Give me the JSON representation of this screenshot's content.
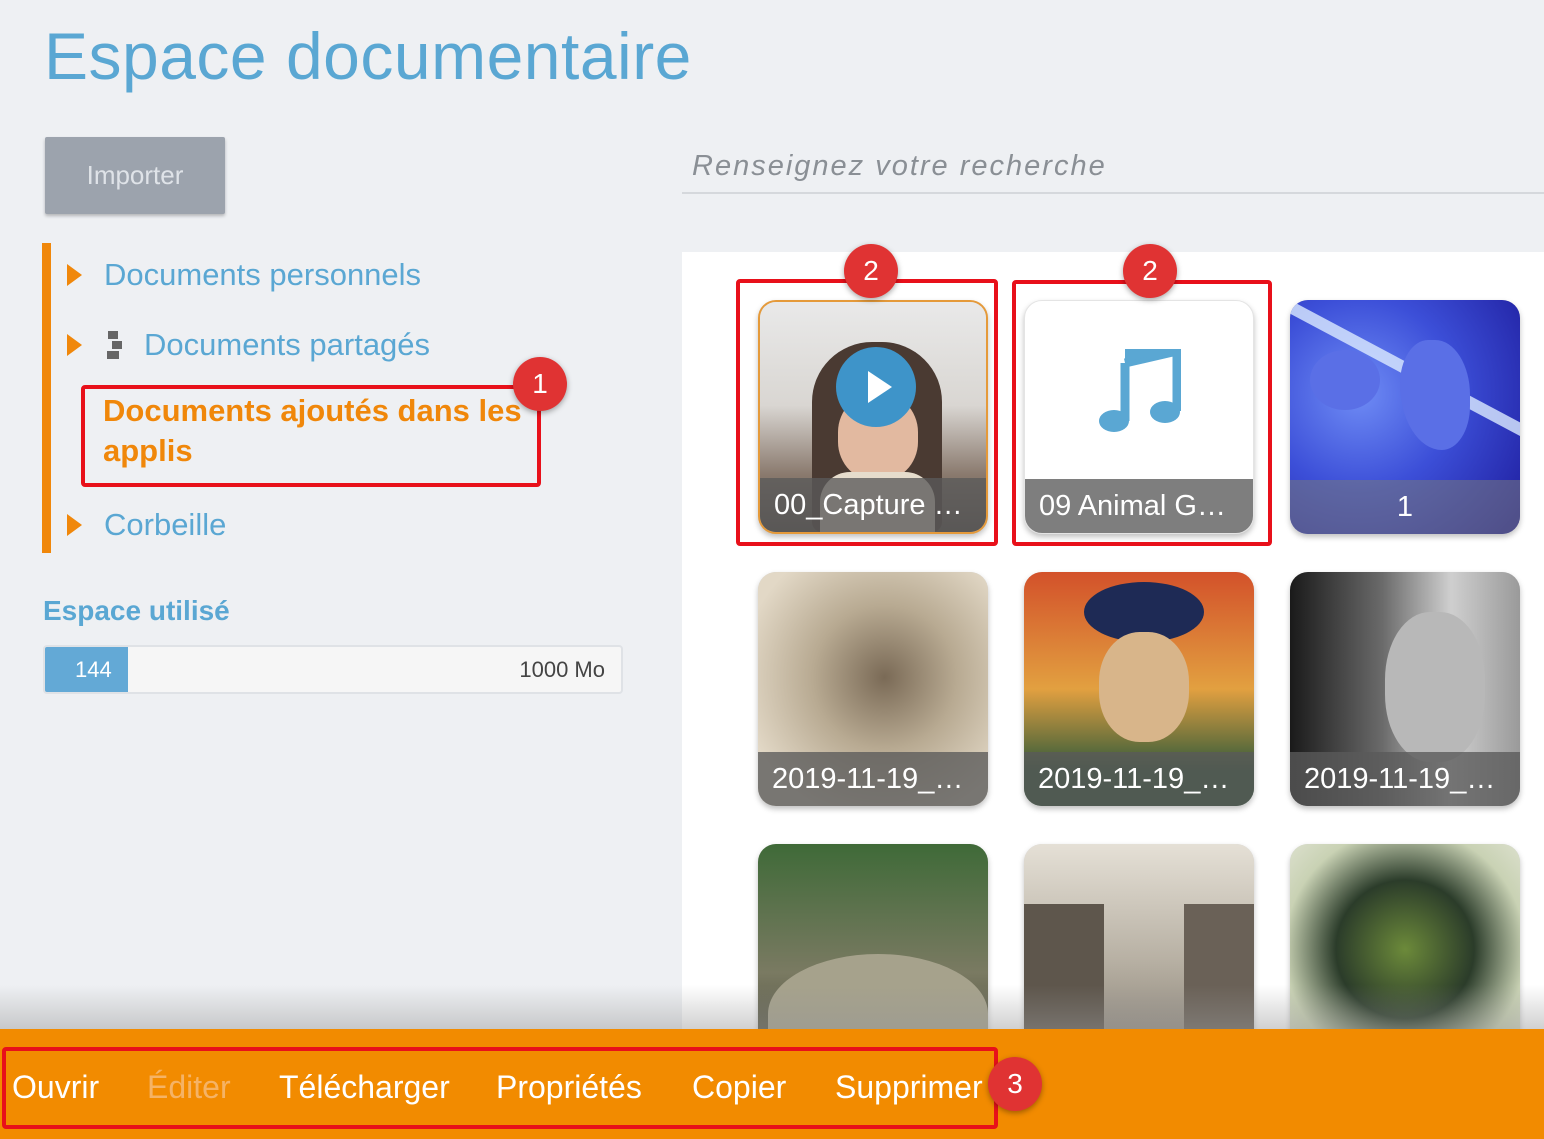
{
  "page": {
    "title": "Espace documentaire"
  },
  "toolbar": {
    "import_label": "Importer",
    "search_placeholder": "Renseignez votre recherche"
  },
  "tree": {
    "items": [
      {
        "label": "Documents personnels"
      },
      {
        "label": "Documents partagés"
      },
      {
        "label": "Documents ajoutés dans les applis",
        "active": true
      },
      {
        "label": "Corbeille"
      }
    ]
  },
  "storage": {
    "title": "Espace utilisé",
    "used": "144",
    "total": "1000 Mo",
    "used_fraction": 0.144
  },
  "documents": [
    {
      "label": "00_Capture 3…",
      "type": "video"
    },
    {
      "label": "09 Animal Ga…",
      "type": "audio"
    },
    {
      "label": "1",
      "type": "image"
    },
    {
      "label": "2019-11-19_1…",
      "type": "image"
    },
    {
      "label": "2019-11-19_1…",
      "type": "image"
    },
    {
      "label": "2019-11-19_1…",
      "type": "image"
    },
    {
      "label": "",
      "type": "image"
    },
    {
      "label": "",
      "type": "image"
    },
    {
      "label": "",
      "type": "image"
    }
  ],
  "actions": {
    "open": "Ouvrir",
    "edit": "Éditer",
    "download": "Télécharger",
    "properties": "Propriétés",
    "copy": "Copier",
    "delete": "Supprimer"
  },
  "annotations": {
    "badge1": "1",
    "badge2a": "2",
    "badge2b": "2",
    "badge3": "3"
  },
  "colors": {
    "accent": "#f28b00",
    "primary": "#5aa7d3",
    "callout": "#e8101a"
  }
}
